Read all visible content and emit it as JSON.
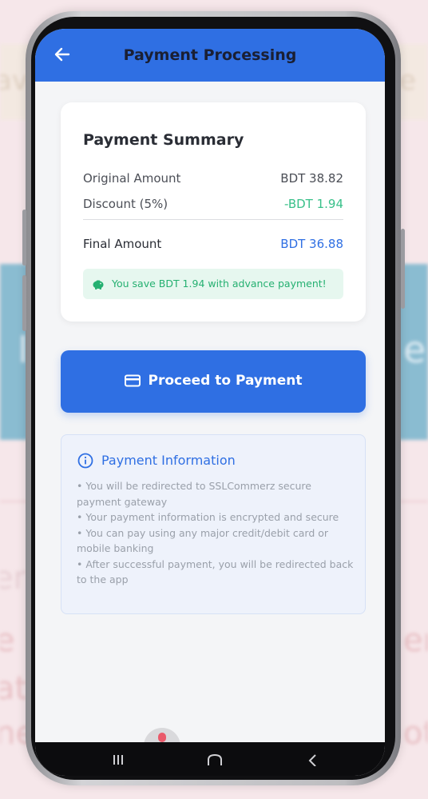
{
  "app_bar": {
    "title": "Payment Processing"
  },
  "summary": {
    "title": "Payment Summary",
    "original_label": "Original Amount",
    "original_value": "BDT 38.82",
    "discount_label": "Discount (5%)",
    "discount_value": "-BDT 1.94",
    "final_label": "Final Amount",
    "final_value": "BDT 36.88",
    "savings_text": "You save BDT 1.94 with advance payment!"
  },
  "proceed_button": {
    "label": "Proceed to Payment"
  },
  "info": {
    "title": "Payment Information",
    "items": [
      "• You will be redirected to SSLCommerz secure payment gateway",
      "• Your payment information is encrypted and secure",
      "• You can pay using any major credit/debit card or mobile banking",
      "• After successful payment, you will be redirected back to the app"
    ]
  },
  "icons": {
    "back": "arrow-left-icon",
    "savings": "piggy-bank-icon",
    "card": "credit-card-icon",
    "info": "info-circle-icon"
  },
  "colors": {
    "primary": "#2f6fe3",
    "success": "#25b071",
    "success_bg": "#e6f7ef",
    "info_bg": "#eef2fb"
  }
}
